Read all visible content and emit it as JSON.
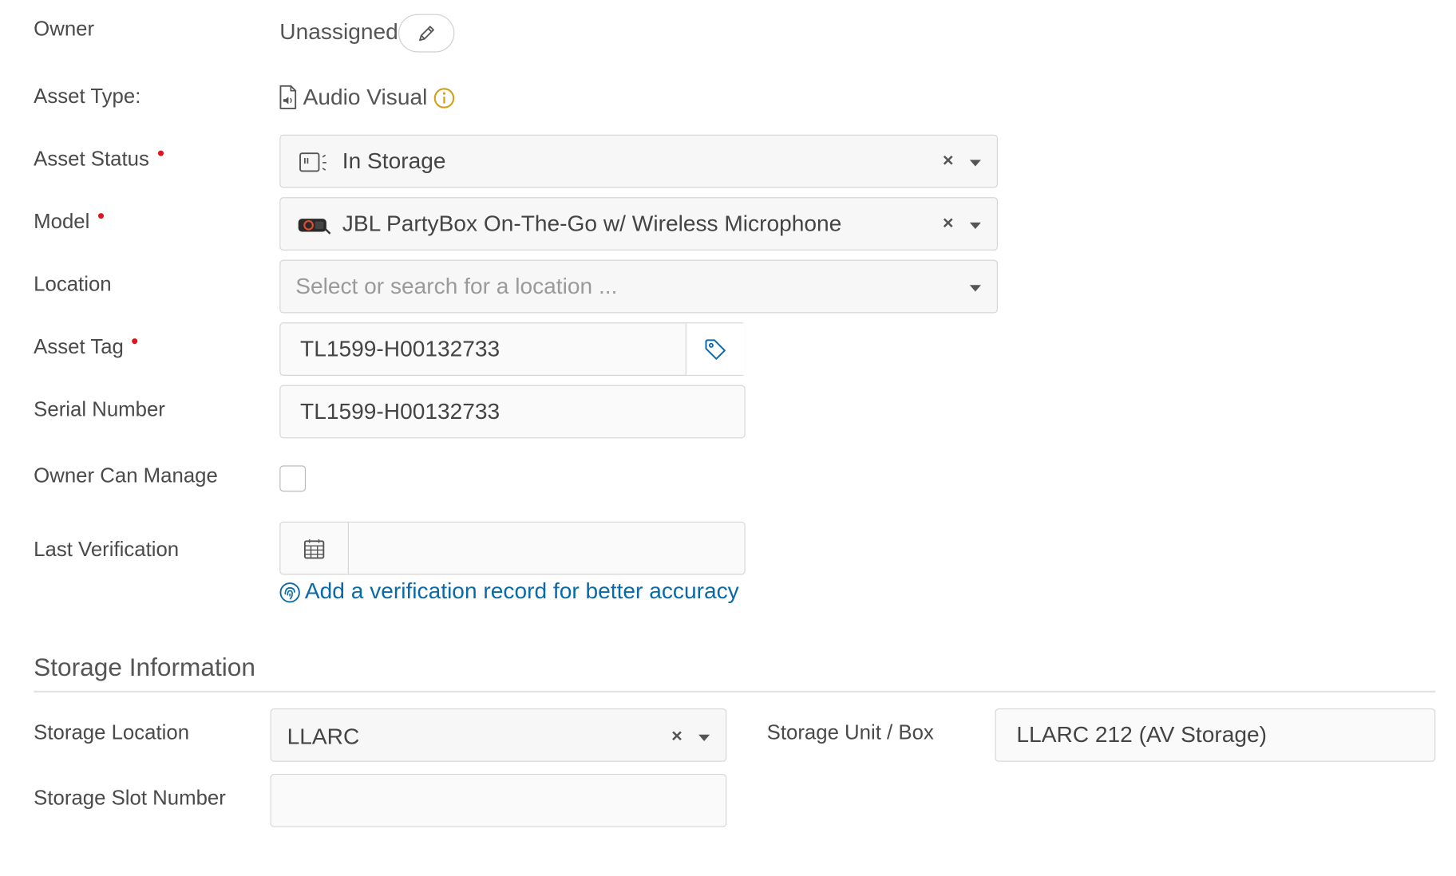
{
  "fields": {
    "owner": {
      "label": "Owner",
      "value": "Unassigned"
    },
    "asset_type": {
      "label": "Asset Type:",
      "value": "Audio Visual"
    },
    "asset_status": {
      "label": "Asset Status",
      "value": "In Storage"
    },
    "model": {
      "label": "Model",
      "value": "JBL PartyBox On-The-Go w/ Wireless Microphone"
    },
    "location": {
      "label": "Location",
      "placeholder": "Select or search for a location ..."
    },
    "asset_tag": {
      "label": "Asset Tag",
      "value": "TL1599-H00132733"
    },
    "serial_number": {
      "label": "Serial Number",
      "value": "TL1599-H00132733"
    },
    "owner_can_manage": {
      "label": "Owner Can Manage",
      "checked": false
    },
    "last_verification": {
      "label": "Last Verification",
      "value": ""
    },
    "verification_link": "Add a verification record for better accuracy"
  },
  "storage": {
    "heading": "Storage Information",
    "storage_location": {
      "label": "Storage Location",
      "value": "LLARC"
    },
    "storage_unit": {
      "label": "Storage Unit / Box",
      "value": "LLARC 212 (AV Storage)"
    },
    "storage_slot": {
      "label": "Storage Slot Number",
      "value": ""
    }
  },
  "icons": {
    "edit": "pencil-icon",
    "asset_type": "audio-file-icon",
    "info": "info-icon",
    "status": "storage-status-icon",
    "model": "speaker-thumbnail",
    "tag": "tag-icon",
    "calendar": "calendar-icon",
    "verify": "fingerprint-icon"
  },
  "colors": {
    "required": "#e0141e",
    "link": "#0a6aa8",
    "info": "#d4a017"
  }
}
